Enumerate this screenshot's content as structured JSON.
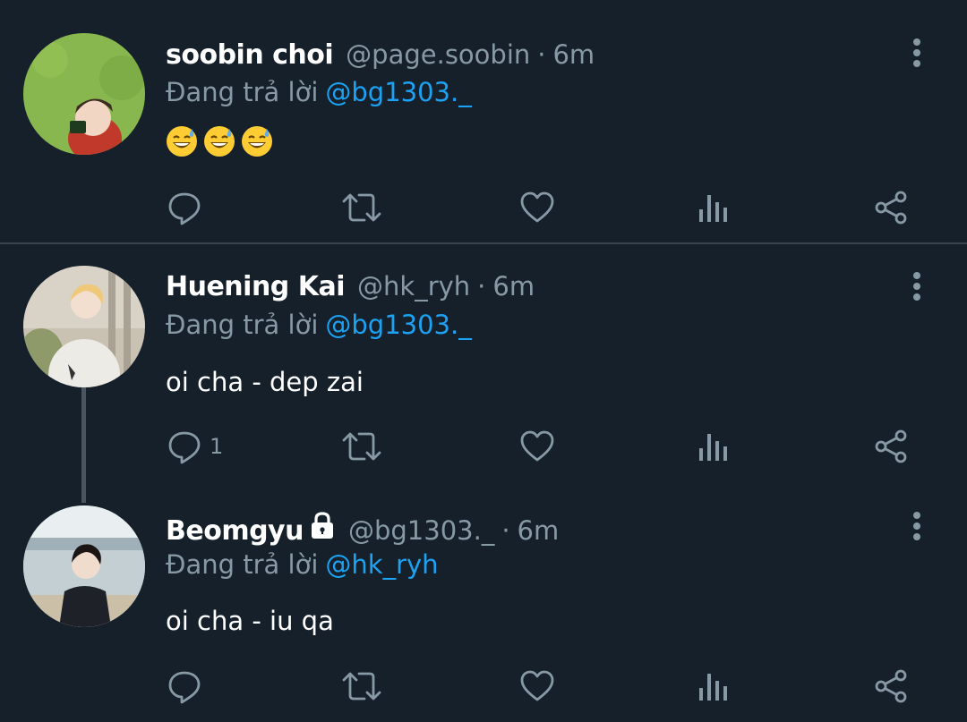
{
  "tweets": [
    {
      "name": "soobin choi",
      "handle": "@page.soobin",
      "separator": "·",
      "time": "6m",
      "reply_prefix": "Đang trả lời",
      "reply_to": "@bg1303._",
      "emojis": [
        "grinning-sweat-emoji",
        "grinning-sweat-emoji",
        "grinning-sweat-emoji"
      ],
      "reply_count": ""
    },
    {
      "name": "Huening Kai",
      "handle": "@hk_ryh",
      "separator": "·",
      "time": "6m",
      "reply_prefix": "Đang trả lời",
      "reply_to": "@bg1303._",
      "text": "oi cha - dep zai",
      "reply_count": "1"
    },
    {
      "name": "Beomgyu",
      "handle": "@bg1303._",
      "separator": "·",
      "time": "6m",
      "reply_prefix": "Đang trả lời",
      "reply_to": "@hk_ryh",
      "text": "oi cha - iu qa",
      "locked": true,
      "reply_count": ""
    }
  ],
  "colors": {
    "background": "#15202b",
    "secondary_text": "#8899a6",
    "mention": "#1da1f2",
    "divider": "#38444d"
  },
  "icons": [
    "reply-icon",
    "retweet-icon",
    "like-icon",
    "analytics-icon",
    "share-icon",
    "more-options-icon",
    "lock-icon"
  ]
}
